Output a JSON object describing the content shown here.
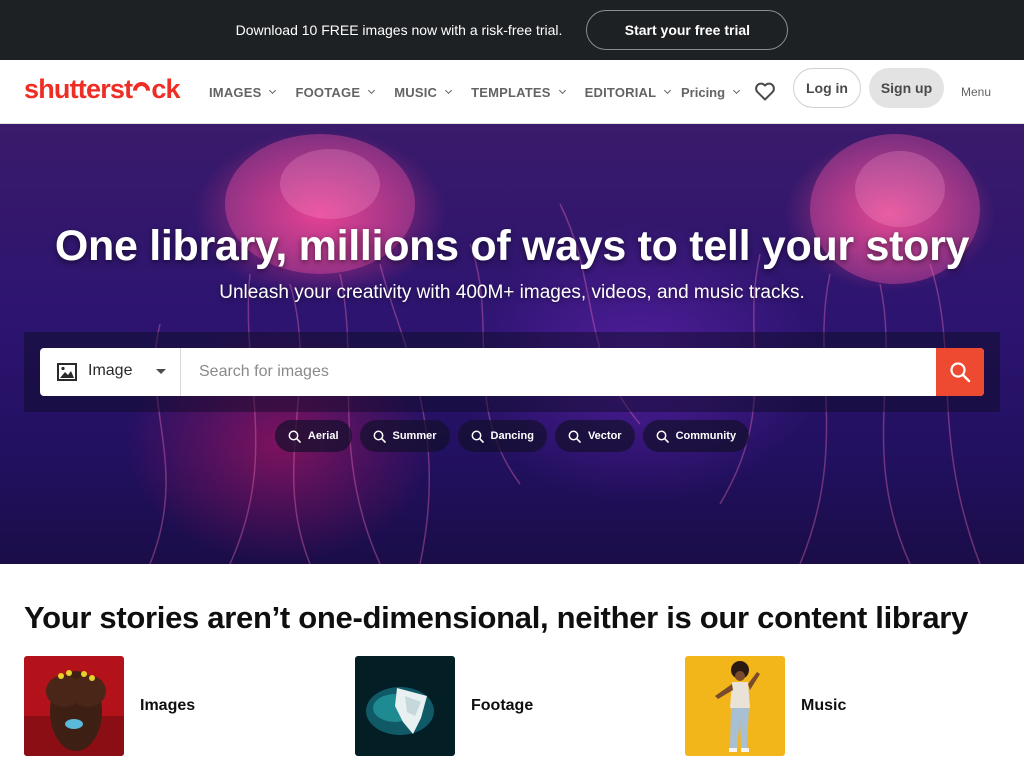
{
  "promo": {
    "text": "Download 10 FREE images now with a risk-free trial.",
    "cta": "Start your free trial"
  },
  "header": {
    "logo": {
      "part1": "shutterst",
      "part2": "ck"
    },
    "nav": [
      {
        "label": "IMAGES"
      },
      {
        "label": "FOOTAGE"
      },
      {
        "label": "MUSIC"
      },
      {
        "label": "TEMPLATES"
      },
      {
        "label": "EDITORIAL"
      }
    ],
    "pricing": "Pricing",
    "favorites_icon": "heart-icon",
    "login": "Log in",
    "signup": "Sign up",
    "menu": "Menu"
  },
  "hero": {
    "title": "One library, millions of ways to tell your story",
    "subtitle": "Unleash your creativity with 400M+ images, videos, and music tracks.",
    "search": {
      "type": "Image",
      "type_icon": "image-icon",
      "placeholder": "Search for images",
      "value": "",
      "button_icon": "search-icon"
    },
    "suggestions": [
      {
        "label": "Aerial"
      },
      {
        "label": "Summer"
      },
      {
        "label": "Dancing"
      },
      {
        "label": "Vector"
      },
      {
        "label": "Community"
      }
    ]
  },
  "content": {
    "title": "Your stories aren’t one-dimensional, neither is our content library",
    "categories": [
      {
        "label": "Images"
      },
      {
        "label": "Footage"
      },
      {
        "label": "Music"
      }
    ]
  },
  "colors": {
    "brand_red": "#ee2d24",
    "search_button": "#ee4a32",
    "promo_bg": "#1e2124"
  }
}
